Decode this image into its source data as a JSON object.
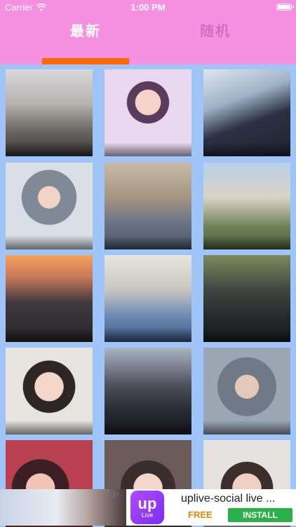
{
  "status_bar": {
    "carrier": "Carrier",
    "time": "1:00 PM",
    "battery_level": 1.0
  },
  "tabs": [
    {
      "label": "最新",
      "selected": true
    },
    {
      "label": "随机",
      "selected": false
    }
  ],
  "colors": {
    "header": "#f690e0",
    "indicator": "#ff6a00",
    "background": "#9ec4f8"
  },
  "grid": {
    "items": [
      {
        "photo": "street-photo"
      },
      {
        "photo": "portrait-photo"
      },
      {
        "photo": "cosplay-photo"
      },
      {
        "photo": "portrait-photo"
      },
      {
        "photo": "street-photo"
      },
      {
        "photo": "outdoor-photo"
      },
      {
        "photo": "sunset-photo"
      },
      {
        "photo": "portrait-photo"
      },
      {
        "photo": "portrait-photo"
      },
      {
        "photo": "portrait-photo"
      },
      {
        "photo": "cosplay-photo"
      },
      {
        "photo": "portrait-photo"
      },
      {
        "photo": "portrait-photo"
      },
      {
        "photo": "portrait-photo"
      },
      {
        "photo": "portrait-photo"
      }
    ]
  },
  "ad": {
    "logo_text": "up",
    "logo_sub": "Live",
    "title": "uplive-social live ...",
    "price": "FREE",
    "button": "INSTALL"
  }
}
